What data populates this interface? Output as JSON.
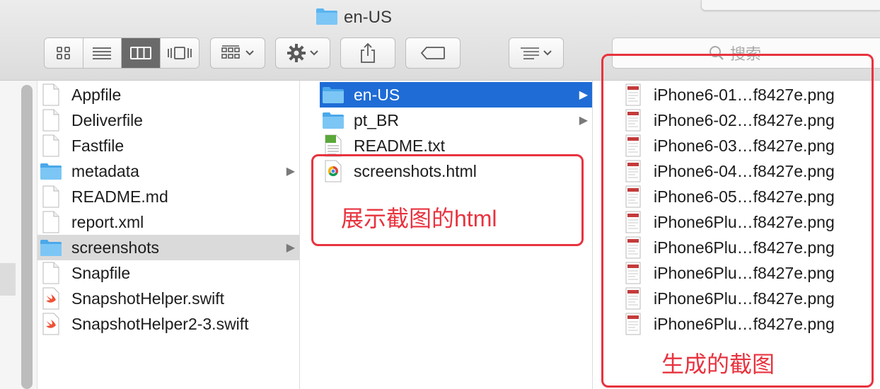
{
  "window": {
    "title": "en-US"
  },
  "toolbar": {
    "search_placeholder": "搜索"
  },
  "column1": [
    {
      "name": "Appfile",
      "icon": "document-icon",
      "arrow": false
    },
    {
      "name": "Deliverfile",
      "icon": "document-icon",
      "arrow": false
    },
    {
      "name": "Fastfile",
      "icon": "document-icon",
      "arrow": false
    },
    {
      "name": "metadata",
      "icon": "folder-icon",
      "arrow": true
    },
    {
      "name": "README.md",
      "icon": "document-icon",
      "arrow": false
    },
    {
      "name": "report.xml",
      "icon": "document-icon",
      "arrow": false
    },
    {
      "name": "screenshots",
      "icon": "folder-icon",
      "arrow": true,
      "selected": true
    },
    {
      "name": "Snapfile",
      "icon": "document-icon",
      "arrow": false
    },
    {
      "name": "SnapshotHelper.swift",
      "icon": "swift-icon",
      "arrow": false
    },
    {
      "name": "SnapshotHelper2-3.swift",
      "icon": "swift-icon",
      "arrow": false
    }
  ],
  "column2": [
    {
      "name": "en-US",
      "icon": "folder-icon",
      "arrow": true,
      "selected": true
    },
    {
      "name": "pt_BR",
      "icon": "folder-icon",
      "arrow": true
    },
    {
      "name": "README.txt",
      "icon": "text-file-icon",
      "arrow": false
    },
    {
      "name": "screenshots.html",
      "icon": "chrome-html-icon",
      "arrow": false
    }
  ],
  "column3": [
    {
      "name": "iPhone6-01…f8427e.png",
      "icon": "png-thumbnail-icon"
    },
    {
      "name": "iPhone6-02…f8427e.png",
      "icon": "png-thumbnail-icon"
    },
    {
      "name": "iPhone6-03…f8427e.png",
      "icon": "png-thumbnail-icon"
    },
    {
      "name": "iPhone6-04…f8427e.png",
      "icon": "png-thumbnail-icon"
    },
    {
      "name": "iPhone6-05…f8427e.png",
      "icon": "png-thumbnail-icon"
    },
    {
      "name": "iPhone6Plu…f8427e.png",
      "icon": "png-thumbnail-icon"
    },
    {
      "name": "iPhone6Plu…f8427e.png",
      "icon": "png-thumbnail-icon"
    },
    {
      "name": "iPhone6Plu…f8427e.png",
      "icon": "png-thumbnail-icon"
    },
    {
      "name": "iPhone6Plu…f8427e.png",
      "icon": "png-thumbnail-icon"
    },
    {
      "name": "iPhone6Plu…f8427e.png",
      "icon": "png-thumbnail-icon"
    }
  ],
  "annotations": {
    "html_label": "展示截图的html",
    "screenshots_label": "生成的截图"
  },
  "colors": {
    "selection_blue": "#1f6cd6",
    "annotation_red": "#e8333f",
    "folder_blue": "#5ab4f0"
  }
}
